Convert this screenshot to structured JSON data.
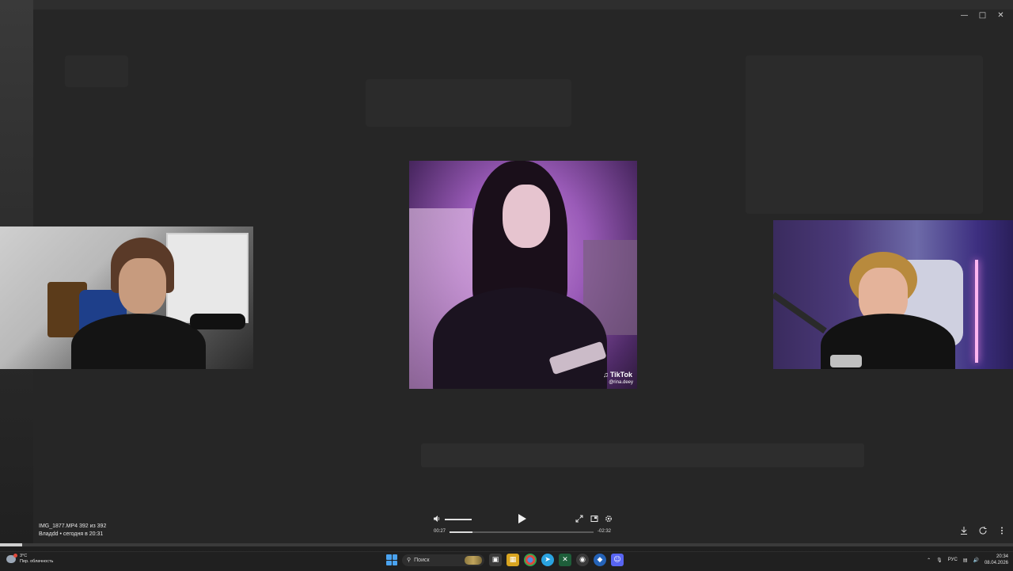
{
  "window": {
    "minimize_icon": "minimize-icon",
    "maximize_icon": "maximize-icon",
    "close_icon": "close-icon"
  },
  "tiktok_overlay": {
    "logo_text": "TikTok",
    "handle": "@rina.deey"
  },
  "media": {
    "file_line": "IMG_1877.MP4 392 из 392",
    "author_line": "Bладdd • сегодня в 20:31"
  },
  "player": {
    "current_time": "00:27",
    "remaining_time": "-02:32",
    "progress_fraction": 0.16,
    "volume_fraction": 1.0,
    "icons": [
      "volume-icon",
      "play-icon",
      "fullscreen-icon",
      "pip-icon",
      "settings-icon"
    ]
  },
  "viewer_tools": {
    "icons": [
      "download-icon",
      "share-icon",
      "more-icon"
    ]
  },
  "taskbar": {
    "weather_temp": "3°C",
    "weather_desc": "Пер. облачность",
    "search_placeholder": "Поиск",
    "language": "РУС",
    "time": "20:34",
    "date": "08.04.2026",
    "accent_color": "#4aa3f0"
  }
}
